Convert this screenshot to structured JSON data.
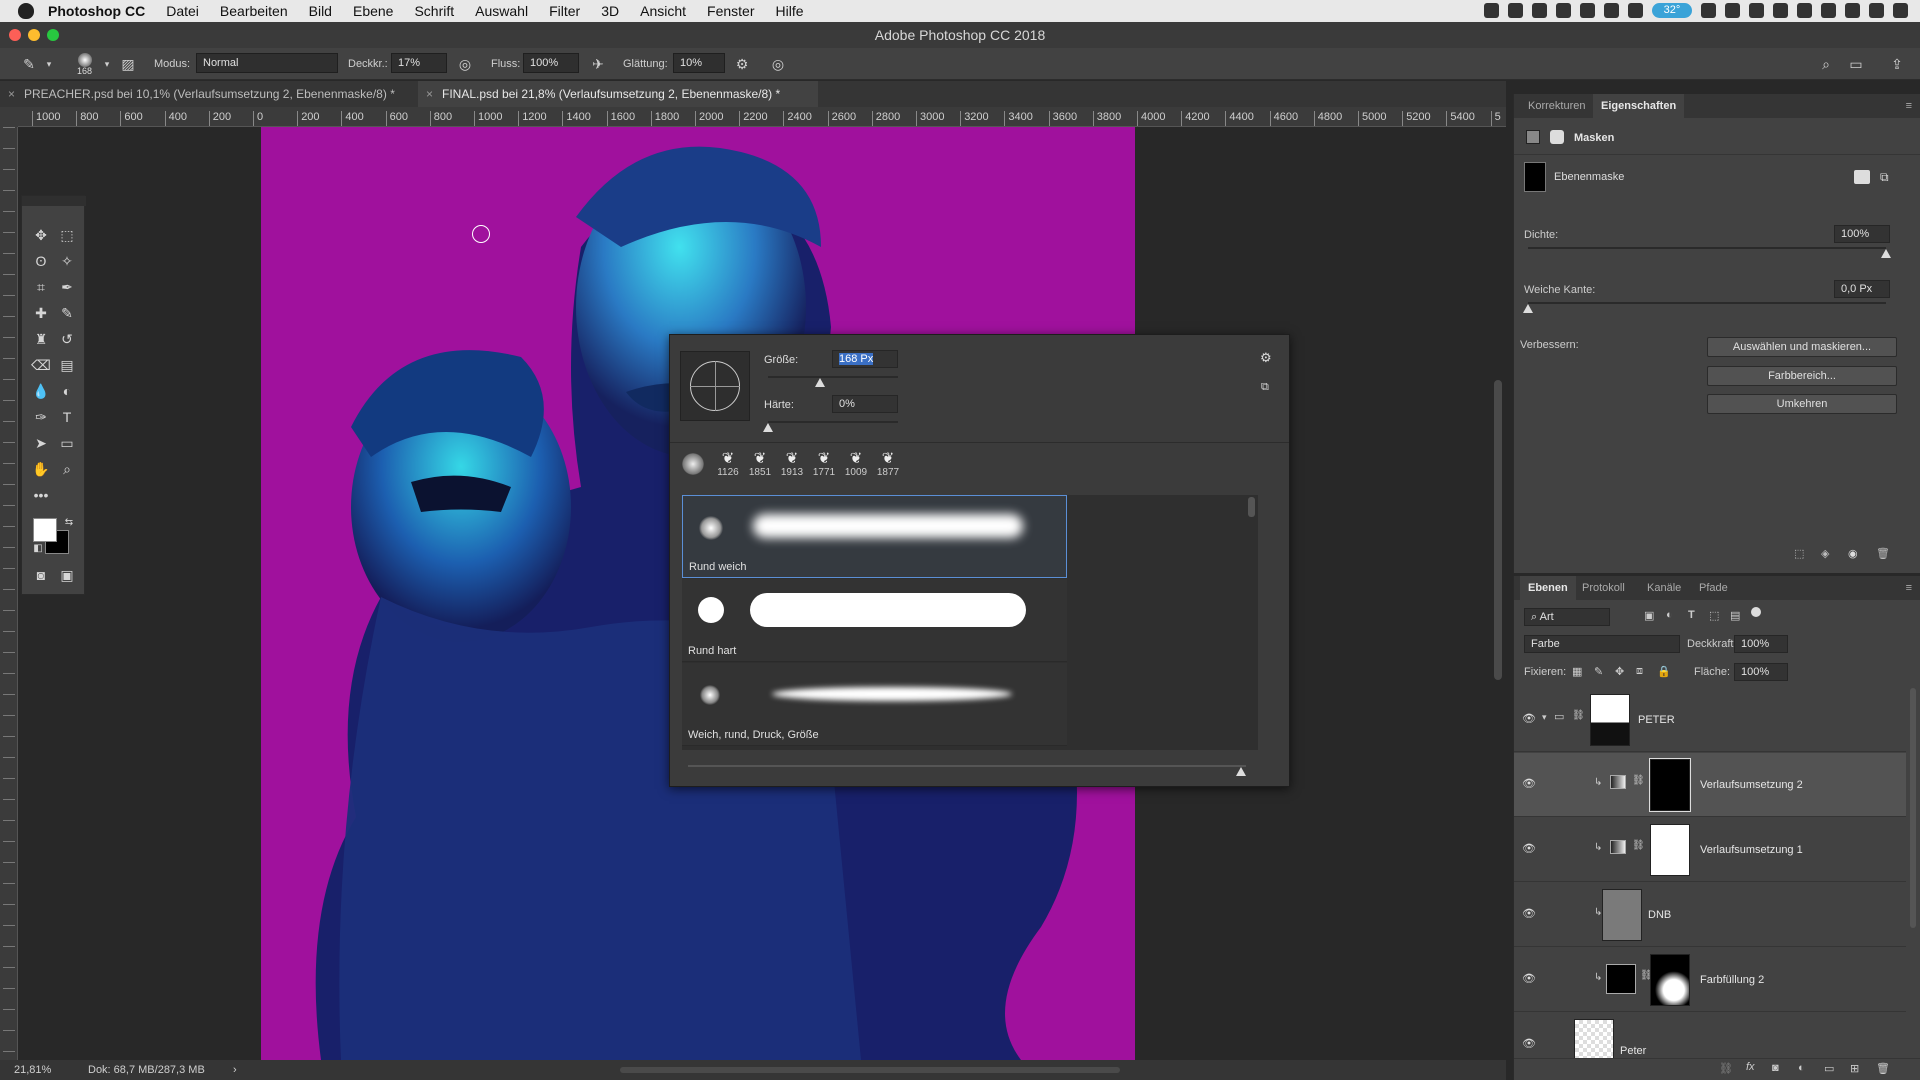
{
  "menubar": {
    "items": [
      "Photoshop CC",
      "Datei",
      "Bearbeiten",
      "Bild",
      "Ebene",
      "Schrift",
      "Auswahl",
      "Filter",
      "3D",
      "Ansicht",
      "Fenster",
      "Hilfe"
    ],
    "badge": "32°"
  },
  "window": {
    "title": "Adobe Photoshop CC 2018"
  },
  "options": {
    "brush_size": "168",
    "mode_label": "Modus:",
    "mode_value": "Normal",
    "opacity_label": "Deckkr.:",
    "opacity_value": "17%",
    "flow_label": "Fluss:",
    "flow_value": "100%",
    "smoothing_label": "Glättung:",
    "smoothing_value": "10%"
  },
  "tabs": [
    {
      "label": "PREACHER.psd bei 10,1% (Verlaufsumsetzung 2, Ebenenmaske/8) *"
    },
    {
      "label": "FINAL.psd bei 21,8% (Verlaufsumsetzung 2, Ebenenmaske/8) *"
    }
  ],
  "ruler_h": [
    "1000",
    "800",
    "600",
    "400",
    "200",
    "0",
    "200",
    "400",
    "600",
    "800",
    "1000",
    "1200",
    "1400",
    "1600",
    "1800",
    "2000",
    "2200",
    "2400",
    "2600",
    "2800",
    "3000",
    "3200",
    "3400",
    "3600",
    "3800",
    "4000",
    "4200",
    "4400",
    "4600",
    "4800",
    "5000",
    "5200",
    "5400",
    "5"
  ],
  "brush_popup": {
    "size_label": "Größe:",
    "size_value": "168 Px",
    "hardness_label": "Härte:",
    "hardness_value": "0%",
    "size_level": 0.4,
    "hardness_level": 0.0,
    "recent_brushes": [
      "1126",
      "1851",
      "1913",
      "1771",
      "1009",
      "1877"
    ],
    "presets": [
      {
        "label": "Rund weich"
      },
      {
        "label": "Rund hart"
      },
      {
        "label": "Weich, rund, Druck, Größe"
      }
    ]
  },
  "properties": {
    "tabs": [
      "Korrekturen",
      "Eigenschaften"
    ],
    "masks_label": "Masken",
    "layer_mask_label": "Ebenenmaske",
    "density_label": "Dichte:",
    "density_value": "100%",
    "density_level": 1.0,
    "feather_label": "Weiche Kante:",
    "feather_value": "0,0 Px",
    "feather_level": 0.0,
    "refine_label": "Verbessern:",
    "select_mask_button": "Auswählen und maskieren...",
    "color_range_button": "Farbbereich...",
    "invert_button": "Umkehren"
  },
  "layers": {
    "tabs": [
      "Ebenen",
      "Protokoll",
      "Kanäle",
      "Pfade"
    ],
    "filter_kind": "Art",
    "blend_mode": "Farbe",
    "opacity_label": "Deckkraft:",
    "opacity_value": "100%",
    "lock_label": "Fixieren:",
    "fill_label": "Fläche:",
    "fill_value": "100%",
    "items": [
      {
        "name": "PETER"
      },
      {
        "name": "Verlaufsumsetzung 2"
      },
      {
        "name": "Verlaufsumsetzung 1"
      },
      {
        "name": "DNB"
      },
      {
        "name": "Farbfüllung 2"
      },
      {
        "name": "Peter"
      }
    ]
  },
  "status": {
    "zoom": "21,81%",
    "doc_size": "Dok: 68,7 MB/287,3 MB"
  },
  "colors": {
    "canvas_bg": "#a0119d",
    "accent": "#5b8fd6"
  }
}
